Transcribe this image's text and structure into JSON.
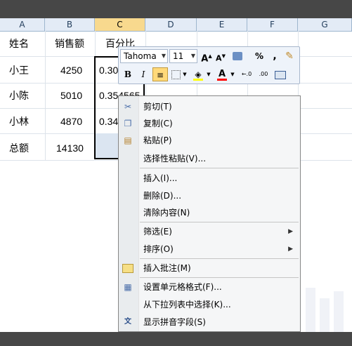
{
  "columns": [
    "A",
    "B",
    "C",
    "D",
    "E",
    "F",
    "G"
  ],
  "rows": [
    {
      "a": "姓名",
      "b": "销售额",
      "c": "百分比"
    },
    {
      "a": "小王",
      "b": "4250",
      "c": "0.30"
    },
    {
      "a": "小陈",
      "b": "5010",
      "c": "0.354565"
    },
    {
      "a": "小林",
      "b": "4870",
      "c": "0.34"
    },
    {
      "a": "总额",
      "b": "14130",
      "c": ""
    }
  ],
  "mini_toolbar": {
    "font_name": "Tahoma",
    "font_size": "11",
    "percent_label": "%",
    "comma_label": ",",
    "bold_label": "B",
    "italic_label": "I",
    "font_color_label": "A",
    "fill_color": "#ffff00",
    "font_color": "#ff0000"
  },
  "context_menu": {
    "items": [
      {
        "label": "剪切(T)",
        "icon": "scissors-icon"
      },
      {
        "label": "复制(C)",
        "icon": "copy-icon"
      },
      {
        "label": "粘贴(P)",
        "icon": "paste-icon"
      },
      {
        "label": "选择性粘贴(V)...",
        "icon": ""
      },
      {
        "label": "插入(I)...",
        "icon": ""
      },
      {
        "label": "删除(D)...",
        "icon": ""
      },
      {
        "label": "清除内容(N)",
        "icon": ""
      },
      {
        "label": "筛选(E)",
        "icon": "",
        "submenu": true
      },
      {
        "label": "排序(O)",
        "icon": "",
        "submenu": true
      },
      {
        "label": "插入批注(M)",
        "icon": "comment-icon"
      },
      {
        "label": "设置单元格格式(F)...",
        "icon": "format-cells-icon"
      },
      {
        "label": "从下拉列表中选择(K)...",
        "icon": ""
      },
      {
        "label": "显示拼音字段(S)",
        "icon": "phonetic-icon"
      }
    ]
  },
  "colors": {
    "selected_header": "#f8d98e",
    "header_bg": "#e3ebf6",
    "dark_bar": "#474747"
  }
}
